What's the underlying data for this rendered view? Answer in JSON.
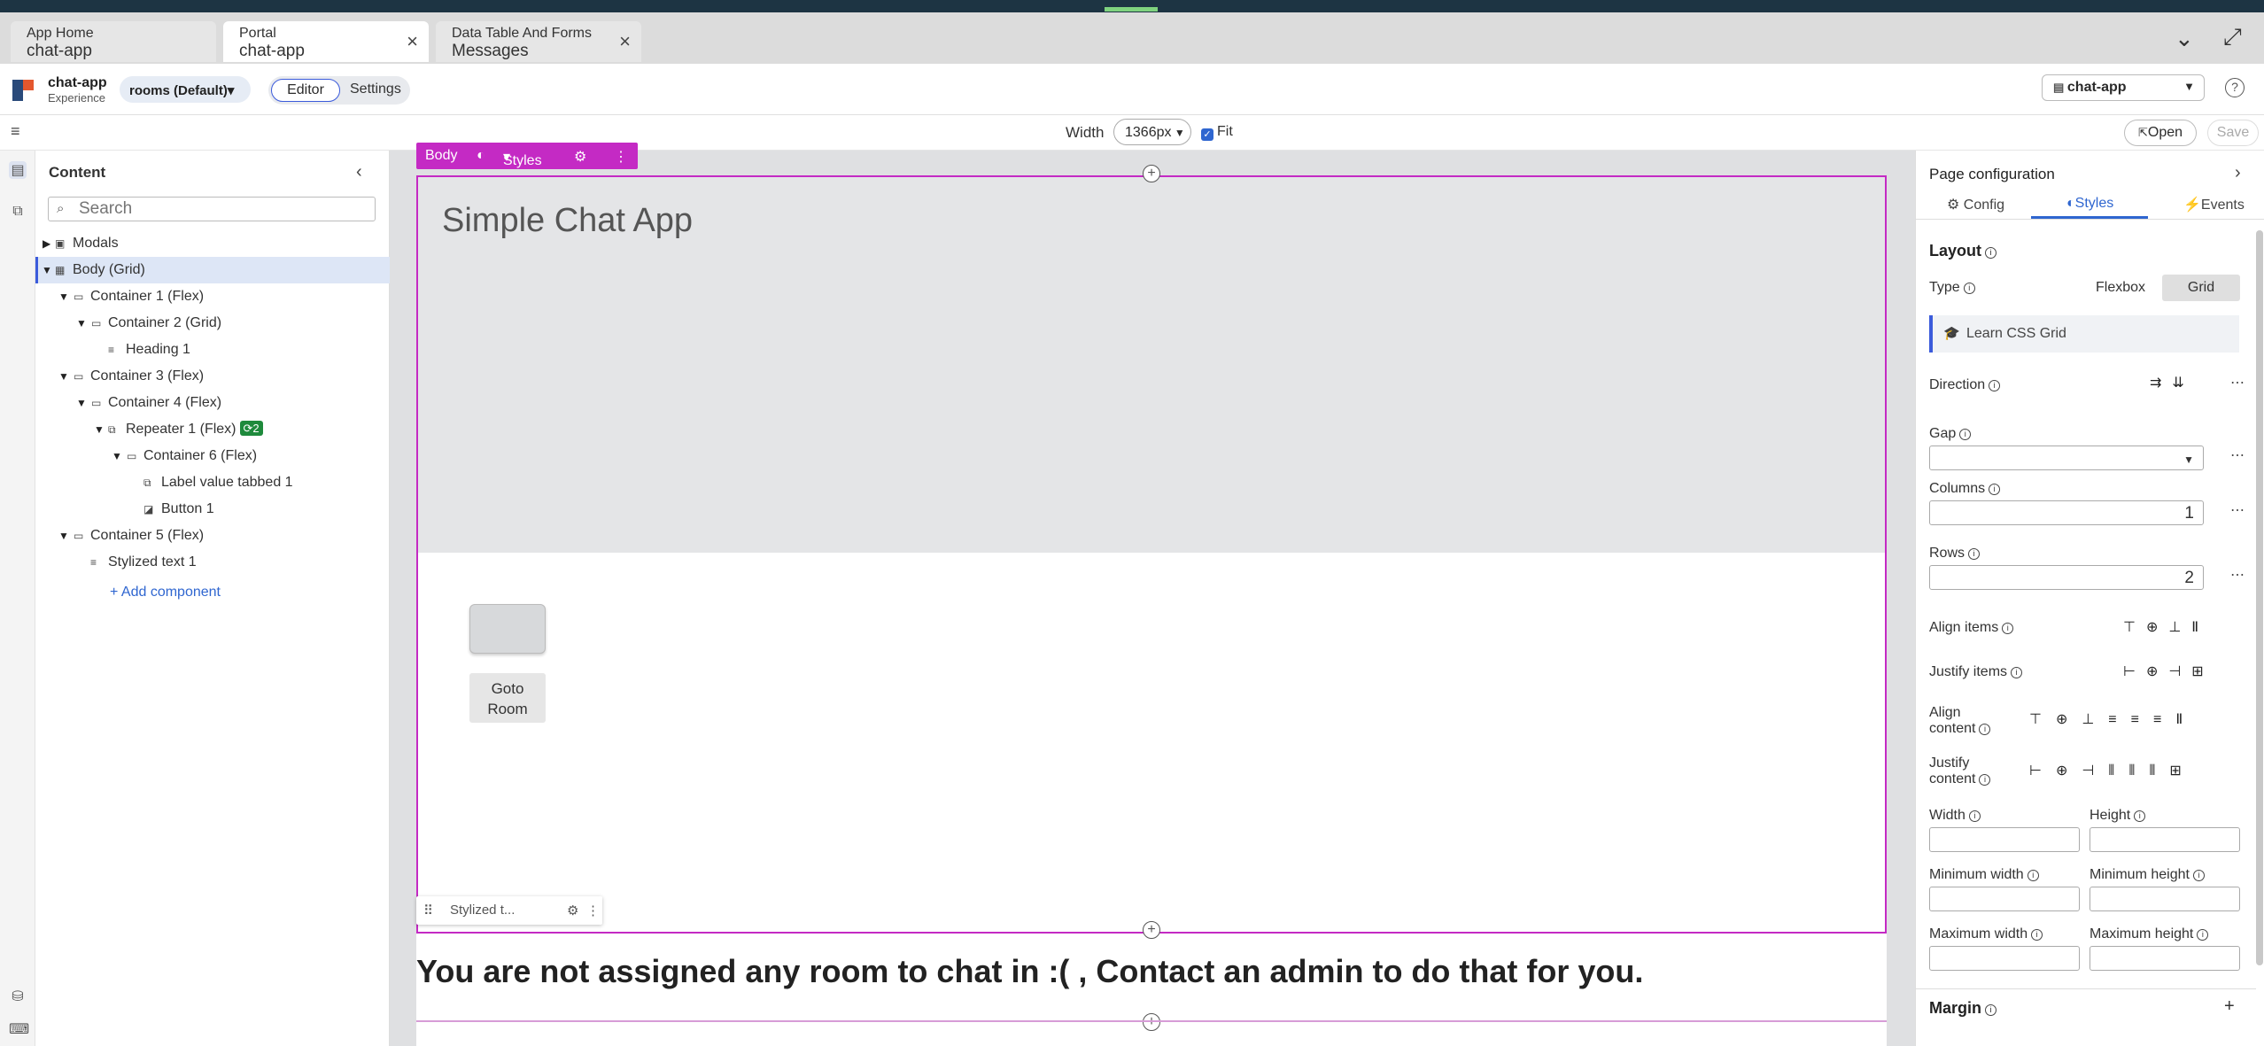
{
  "tabs": [
    {
      "title": "App Home",
      "subtitle": "chat-app"
    },
    {
      "title": "Portal",
      "subtitle": "chat-app"
    },
    {
      "title": "Data Table And Forms",
      "subtitle": "Messages"
    }
  ],
  "appbar": {
    "app_name": "chat-app",
    "app_type": "Experience",
    "page_selector": "rooms (Default)",
    "editor_label": "Editor",
    "settings_label": "Settings",
    "app_selector": "chat-app"
  },
  "toolbar": {
    "width_label": "Width",
    "width_value": "1366px",
    "fit_label": "Fit",
    "open_label": "Open",
    "save_label": "Save"
  },
  "content_panel": {
    "title": "Content",
    "search_placeholder": "Search",
    "tree": [
      {
        "label": "Modals"
      },
      {
        "label": "Body (Grid)"
      },
      {
        "label": "Container 1 (Flex)"
      },
      {
        "label": "Container 2 (Grid)"
      },
      {
        "label": "Heading 1"
      },
      {
        "label": "Container 3 (Flex)"
      },
      {
        "label": "Container 4 (Flex)"
      },
      {
        "label": "Repeater 1 (Flex)",
        "badge": "2"
      },
      {
        "label": "Container 6 (Flex)"
      },
      {
        "label": "Label value tabbed 1"
      },
      {
        "label": "Button 1"
      },
      {
        "label": "Container 5 (Flex)"
      },
      {
        "label": "Stylized text 1"
      }
    ],
    "add_component": "+ Add component"
  },
  "canvas": {
    "body_label": "Body",
    "styles_label": "Styles",
    "heading": "Simple Chat App",
    "goto_room": "Goto Room",
    "mini_label": "Stylized t...",
    "message": "You are not assigned any room to chat in :( , Contact an admin to do that for you."
  },
  "page_config": {
    "title": "Page configuration",
    "tabs": [
      "Config",
      "Styles",
      "Events"
    ],
    "layout_section": "Layout",
    "type_label": "Type",
    "type_options": [
      "Flexbox",
      "Grid"
    ],
    "learn_link": "Learn CSS Grid",
    "direction_label": "Direction",
    "gap_label": "Gap",
    "columns_label": "Columns",
    "columns_value": "1",
    "rows_label": "Rows",
    "rows_value": "2",
    "align_items_label": "Align items",
    "justify_items_label": "Justify items",
    "align_content_label_1": "Align",
    "align_content_label_2": "content",
    "justify_content_label_1": "Justify",
    "justify_content_label_2": "content",
    "width_label": "Width",
    "height_label": "Height",
    "min_width_label": "Minimum width",
    "min_height_label": "Minimum height",
    "max_width_label": "Maximum width",
    "max_height_label": "Maximum height",
    "margin_label": "Margin"
  },
  "colors": {
    "accent": "#3b5bdb",
    "selection": "#c42ac4",
    "badge": "#1e8a3c"
  }
}
